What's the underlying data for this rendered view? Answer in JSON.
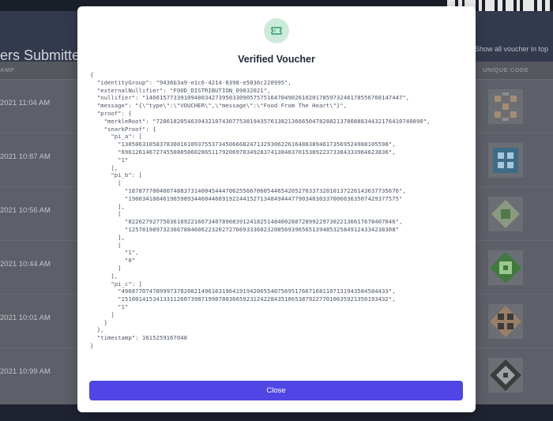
{
  "page": {
    "title_fragment": "ers Submitted",
    "right_hint": "Show all voucher in top",
    "columns": {
      "date": "AMP",
      "code": "UNIQUE CODE"
    },
    "rows": [
      {
        "time": "2021 11:04 AM"
      },
      {
        "time": "2021 10:87 AM"
      },
      {
        "time": "2021 10:56 AM"
      },
      {
        "time": "2021 10:44 AM"
      },
      {
        "time": "2021 10:01 AM"
      },
      {
        "time": "2021 10:99 AM"
      }
    ]
  },
  "modal": {
    "icon": "ticket-icon",
    "title": "Verified Voucher",
    "json_text": "{\n  \"identityGroup\": \"9436b3a9-e1c6-4214-8398-e5036c220995\",\n  \"externalNullifier\": \"FOOD_DISTRIBUTION_09032021\",\n  \"nullifier\": \"14661577339109480342739503309057575164704902610201785973246178556760147447\",\n  \"message\": \"{\\\"type\\\":\\\"VOUCHER\\\",\\\"message\\\":\\\"Food From The Heart\\\"}\",\n  \"proof\": {\n    \"merkleRoot\": \"72061820546394321074307753819435761382136665047828821378088834432176410740890\",\n    \"snarkProof\": {\n      \"pi_a\": [\n        \"13050631058378300161093755373450666824713293062261648838946173569524988105598\",\n        \"69612614672745508050602865117920697034928374138403701538922373384333964623836\",\n        \"1\"\n      ],\n      \"pi_b\": [\n        [\n          \"187877700460748837314004544470625566706054465420527633732810137226143637735676\",\n          \"190034186461965989344604466919224415271348494447790340303370060363507429377575\"\n        ],\n        [\n          \"82262792775036189221667340789083912418251484002887289922973022136617678407046\",\n          \"12578198973236678846062232027276693336023208569396565139485325849124334238308\"\n        ],\n        [\n          \"1\",\n          \"0\"\n        ]\n      ],\n      \"pi_c\": [\n        \"49687707478999737820821496163196419194206554075695176671681107131943584584433\",\n        \"15100141534133112607398719907803665923124228435106538792277010635921350193432\",\n        \"1\"\n      ]\n    }\n  },\n  \"timestamp\": 1615259167048\n}",
    "close_label": "Close"
  },
  "colors": {
    "accent": "#4f46e5",
    "icon_bg": "#cdebdc",
    "icon_fg": "#2f9e68"
  }
}
